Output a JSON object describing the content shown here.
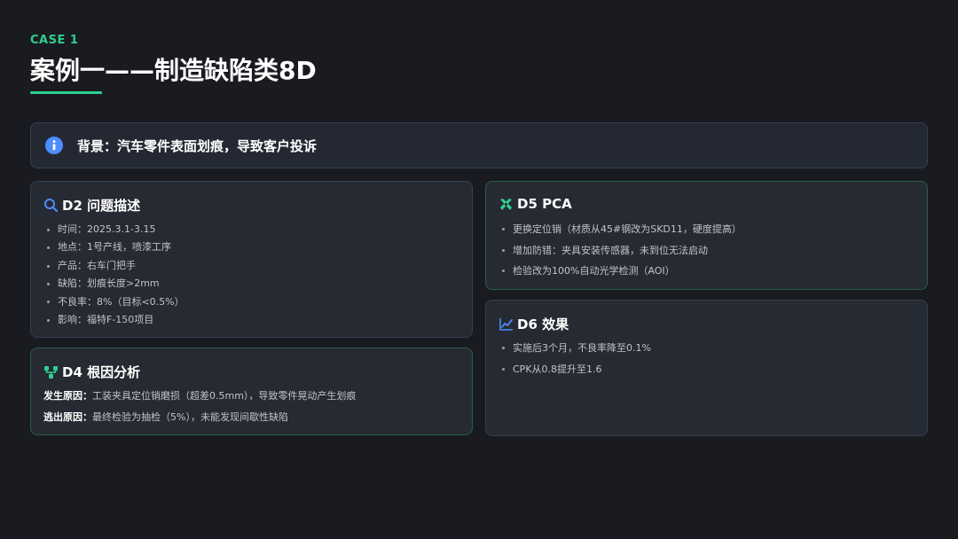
{
  "header": {
    "case_tag": "CASE 1",
    "title": "案例一——制造缺陷类8D"
  },
  "banner": {
    "icon": "info-icon",
    "text": "背景：汽车零件表面划痕，导致客户投诉"
  },
  "d2": {
    "icon": "search-icon",
    "title": "D2 问题描述",
    "items": [
      "时间：2025.3.1-3.15",
      "地点：1号产线，喷漆工序",
      "产品：右车门把手",
      "缺陷：划痕长度>2mm",
      "不良率：8%（目标<0.5%）",
      "影响：福特F-150项目"
    ]
  },
  "d4": {
    "icon": "branch-icon",
    "title": "D4 根因分析",
    "occur_label": "发生原因：",
    "occur_text": "工装夹具定位销磨损（超差0.5mm），导致零件晃动产生划痕",
    "escape_label": "逃出原因：",
    "escape_text": "最终检验为抽检（5%），未能发现间歇性缺陷"
  },
  "d5": {
    "icon": "tools-icon",
    "title": "D5 PCA",
    "items": [
      "更换定位销（材质从45#钢改为SKD11，硬度提高）",
      "增加防错：夹具安装传感器，未到位无法启动",
      "检验改为100%自动光学检测（AOI）"
    ]
  },
  "d6": {
    "icon": "line-chart-icon",
    "title": "D6 效果",
    "items": [
      "实施后3个月，不良率降至0.1%",
      "CPK从0.8提升至1.6"
    ]
  },
  "colors": {
    "accent_green": "#2fcf91",
    "accent_blue": "#4d8dff",
    "background": "#191b20",
    "card": "#262a33"
  }
}
